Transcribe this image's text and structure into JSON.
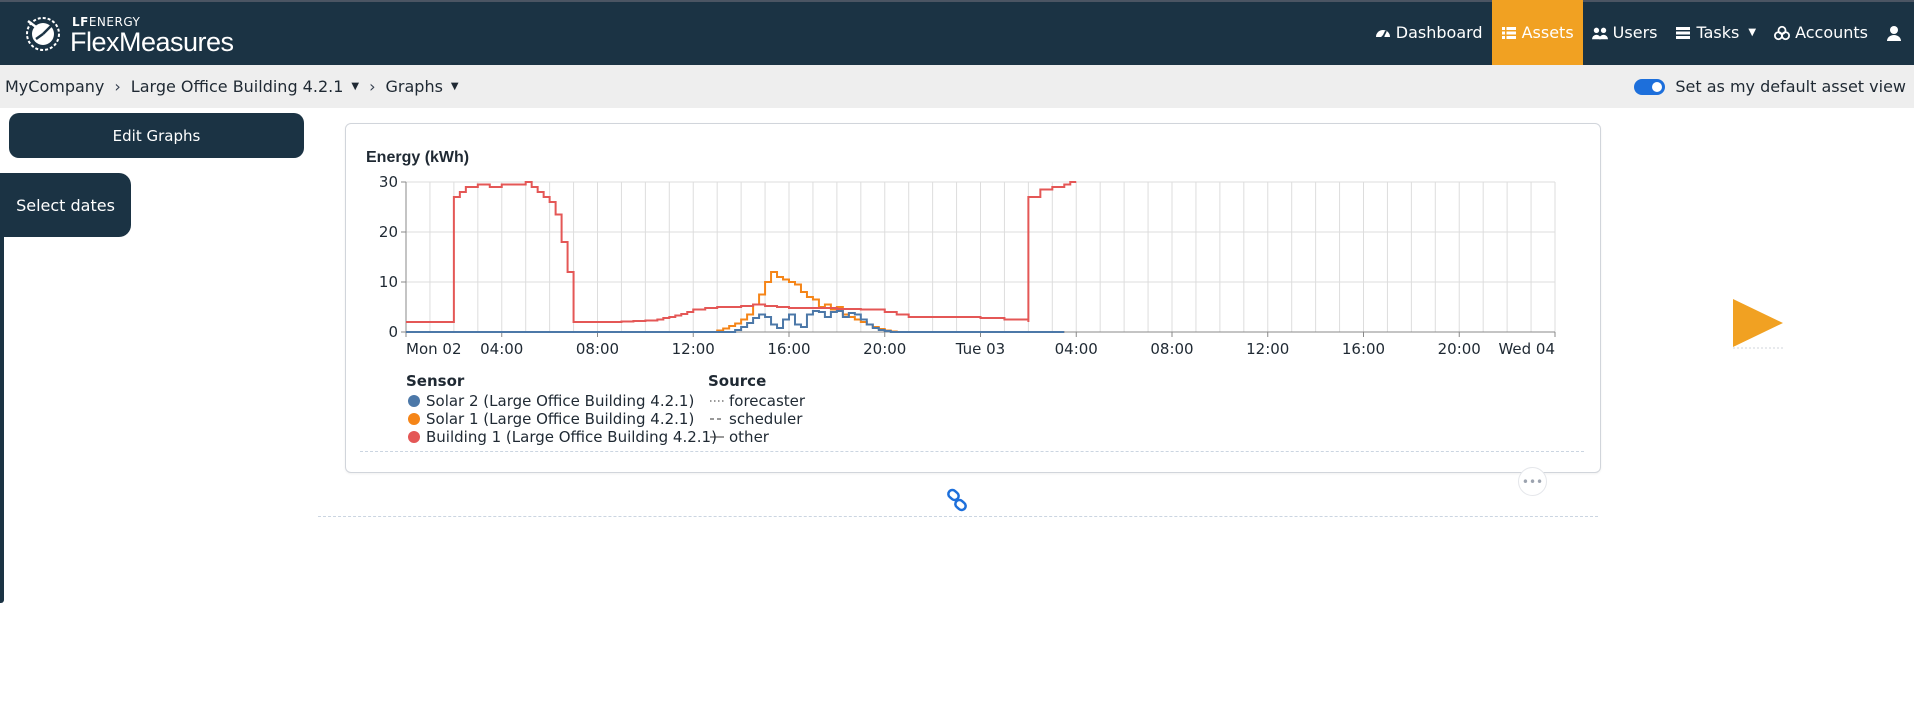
{
  "brand": {
    "lf_bold": "LF",
    "lf_rest": "ENERGY",
    "name": "FlexMeasures"
  },
  "nav": {
    "items": [
      {
        "label": "Dashboard",
        "icon": "dashboard-icon",
        "active": false
      },
      {
        "label": "Assets",
        "icon": "list-icon",
        "active": true
      },
      {
        "label": "Users",
        "icon": "users-icon",
        "active": false
      },
      {
        "label": "Tasks",
        "icon": "tasks-icon",
        "active": false,
        "dropdown": true
      },
      {
        "label": "Accounts",
        "icon": "accounts-icon",
        "active": false
      }
    ],
    "user_icon": "user-icon"
  },
  "breadcrumbs": {
    "account": "MyCompany",
    "asset": "Large Office Building 4.2.1",
    "page": "Graphs"
  },
  "default_view": {
    "label": "Set as my default asset view",
    "checked": true
  },
  "sidebar": {
    "edit_label": "Edit Graphs",
    "dates_label": "Select dates"
  },
  "colors": {
    "navbar": "#1b3344",
    "accent": "#f1a122",
    "solar2": "#4c78a8",
    "solar1": "#f58518",
    "building1": "#e45756"
  },
  "chart_data": {
    "type": "line",
    "title": "Energy (kWh)",
    "ylim": [
      0,
      30
    ],
    "yticks": [
      0,
      10,
      20,
      30
    ],
    "xlim_hours": [
      0,
      48
    ],
    "xtick_labels": [
      "Mon 02",
      "04:00",
      "08:00",
      "12:00",
      "16:00",
      "20:00",
      "Tue 03",
      "04:00",
      "08:00",
      "12:00",
      "16:00",
      "20:00",
      "Wed 04"
    ],
    "grid": true,
    "step": true,
    "legend": {
      "sensor_title": "Sensor",
      "source_title": "Source",
      "sources": [
        {
          "name": "forecaster",
          "dash": "dotted"
        },
        {
          "name": "scheduler",
          "dash": "dashed"
        },
        {
          "name": "other",
          "dash": "solid"
        }
      ]
    },
    "series": [
      {
        "name": "Solar 2 (Large Office Building 4.2.1)",
        "color": "#4c78a8",
        "points": [
          [
            0,
            0
          ],
          [
            13.5,
            0
          ],
          [
            13.75,
            0.4
          ],
          [
            14.0,
            1.0
          ],
          [
            14.25,
            1.8
          ],
          [
            14.5,
            2.8
          ],
          [
            14.75,
            3.5
          ],
          [
            15.0,
            3.0
          ],
          [
            15.25,
            1.5
          ],
          [
            15.5,
            0.8
          ],
          [
            15.75,
            2.5
          ],
          [
            16.0,
            3.5
          ],
          [
            16.25,
            1.5
          ],
          [
            16.5,
            1.0
          ],
          [
            16.75,
            3.5
          ],
          [
            17.0,
            4.2
          ],
          [
            17.25,
            4.0
          ],
          [
            17.5,
            3.0
          ],
          [
            17.75,
            4.0
          ],
          [
            18.0,
            4.2
          ],
          [
            18.25,
            3.0
          ],
          [
            18.5,
            3.8
          ],
          [
            18.75,
            3.5
          ],
          [
            19.0,
            2.5
          ],
          [
            19.25,
            1.5
          ],
          [
            19.5,
            0.8
          ],
          [
            19.75,
            0.4
          ],
          [
            20.0,
            0.2
          ],
          [
            20.25,
            0
          ],
          [
            27.5,
            0
          ]
        ]
      },
      {
        "name": "Solar 1 (Large Office Building 4.2.1)",
        "color": "#f58518",
        "points": [
          [
            0,
            0
          ],
          [
            12.75,
            0
          ],
          [
            13.0,
            0.3
          ],
          [
            13.25,
            0.7
          ],
          [
            13.5,
            1.2
          ],
          [
            13.75,
            1.7
          ],
          [
            14.0,
            2.5
          ],
          [
            14.25,
            3.5
          ],
          [
            14.5,
            5.5
          ],
          [
            14.75,
            7.5
          ],
          [
            15.0,
            10.0
          ],
          [
            15.25,
            12.0
          ],
          [
            15.5,
            11.0
          ],
          [
            15.75,
            10.5
          ],
          [
            16.0,
            10.0
          ],
          [
            16.25,
            9.5
          ],
          [
            16.5,
            8.0
          ],
          [
            16.75,
            7.0
          ],
          [
            17.0,
            6.5
          ],
          [
            17.25,
            5.0
          ],
          [
            17.5,
            5.5
          ],
          [
            17.75,
            4.5
          ],
          [
            18.0,
            5.0
          ],
          [
            18.25,
            3.5
          ],
          [
            18.5,
            3.0
          ],
          [
            18.75,
            2.5
          ],
          [
            19.0,
            2.0
          ],
          [
            19.25,
            1.5
          ],
          [
            19.5,
            1.0
          ],
          [
            19.75,
            0.6
          ],
          [
            20.0,
            0.3
          ],
          [
            20.25,
            0.1
          ],
          [
            20.5,
            0
          ],
          [
            27.5,
            0
          ]
        ]
      },
      {
        "name": "Building 1 (Large Office Building 4.2.1)",
        "color": "#e45756",
        "points": [
          [
            0,
            2.0
          ],
          [
            2.0,
            27.0
          ],
          [
            2.25,
            28.0
          ],
          [
            2.5,
            29.0
          ],
          [
            3.0,
            29.5
          ],
          [
            3.5,
            29.0
          ],
          [
            4.0,
            29.5
          ],
          [
            5.0,
            30.0
          ],
          [
            5.25,
            29.0
          ],
          [
            5.5,
            28.0
          ],
          [
            5.75,
            27.0
          ],
          [
            6.0,
            26.0
          ],
          [
            6.25,
            23.5
          ],
          [
            6.5,
            18.0
          ],
          [
            6.75,
            12.0
          ],
          [
            7.0,
            2.0
          ],
          [
            9.0,
            2.1
          ],
          [
            9.5,
            2.2
          ],
          [
            10.0,
            2.3
          ],
          [
            10.5,
            2.5
          ],
          [
            10.75,
            2.8
          ],
          [
            11.0,
            3.0
          ],
          [
            11.25,
            3.3
          ],
          [
            11.5,
            3.6
          ],
          [
            11.75,
            4.0
          ],
          [
            12.0,
            4.5
          ],
          [
            12.5,
            4.8
          ],
          [
            13.0,
            5.0
          ],
          [
            13.5,
            5.0
          ],
          [
            14.0,
            5.2
          ],
          [
            14.5,
            5.5
          ],
          [
            15.0,
            5.2
          ],
          [
            15.5,
            5.0
          ],
          [
            16.0,
            4.8
          ],
          [
            17.0,
            4.8
          ],
          [
            18.0,
            4.6
          ],
          [
            19.0,
            4.5
          ],
          [
            20.0,
            4.0
          ],
          [
            20.5,
            3.5
          ],
          [
            21.0,
            3.0
          ],
          [
            22.0,
            3.0
          ],
          [
            24.0,
            2.8
          ],
          [
            25.0,
            2.5
          ],
          [
            26.0,
            2.0
          ],
          [
            26.0,
            27.0
          ],
          [
            26.5,
            28.5
          ],
          [
            27.0,
            29.0
          ],
          [
            27.5,
            29.5
          ],
          [
            27.75,
            30.0
          ],
          [
            28.0,
            30.0
          ]
        ]
      }
    ]
  }
}
